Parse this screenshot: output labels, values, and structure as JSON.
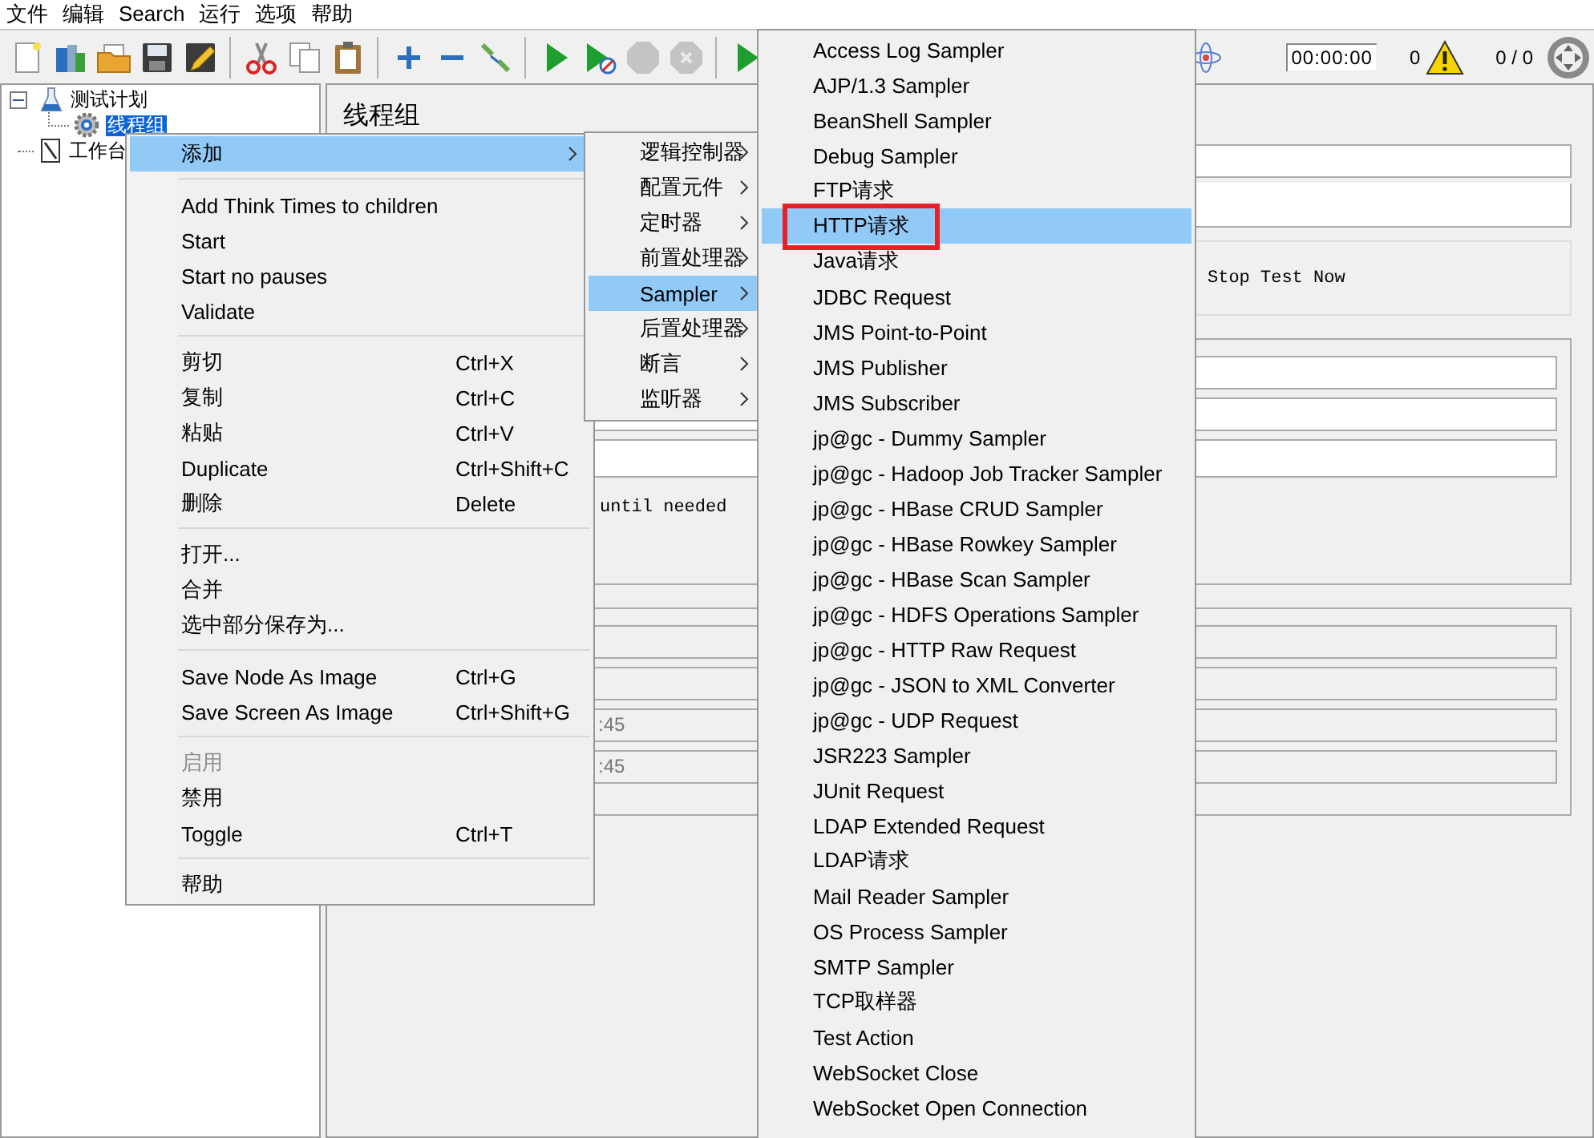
{
  "menubar": [
    {
      "label": "文件"
    },
    {
      "label": "编辑"
    },
    {
      "label": "Search"
    },
    {
      "label": "运行"
    },
    {
      "label": "选项"
    },
    {
      "label": "帮助"
    }
  ],
  "toolbar": [
    {
      "kind": "new",
      "disabled": false
    },
    {
      "kind": "templates",
      "disabled": false
    },
    {
      "kind": "open",
      "disabled": false
    },
    {
      "kind": "save",
      "disabled": false
    },
    {
      "kind": "edit",
      "disabled": false
    },
    {
      "kind": "separator"
    },
    {
      "kind": "cut",
      "disabled": false
    },
    {
      "kind": "copy",
      "disabled": false
    },
    {
      "kind": "paste",
      "disabled": false
    },
    {
      "kind": "separator"
    },
    {
      "kind": "expand",
      "disabled": false
    },
    {
      "kind": "collapse",
      "disabled": false
    },
    {
      "kind": "toggle",
      "disabled": false
    },
    {
      "kind": "separator"
    },
    {
      "kind": "start",
      "disabled": false
    },
    {
      "kind": "start_no_pauses",
      "disabled": false
    },
    {
      "kind": "stop",
      "disabled": true
    },
    {
      "kind": "shutdown",
      "disabled": true
    },
    {
      "kind": "separator"
    },
    {
      "kind": "remote",
      "disabled": false
    }
  ],
  "status": {
    "timer": "00:00:00",
    "error_count": "0",
    "threads": "0 / 0"
  },
  "tree": [
    {
      "kind": "plan",
      "label": "测试计划",
      "expanded": true,
      "selected": false,
      "children": [
        {
          "kind": "thread_group",
          "label": "线程组",
          "selected": true
        }
      ]
    },
    {
      "kind": "workbench",
      "label": "工作台",
      "selected": false
    }
  ],
  "panel": {
    "title": "线程组",
    "action_option": {
      "label": "Stop Test Now"
    },
    "delay_note": "until needed",
    "times": [
      ":45",
      ":45"
    ]
  },
  "context_menu": [
    {
      "kind": "item",
      "label": "添加",
      "arrow": true,
      "disabled": false,
      "selected": true
    },
    {
      "kind": "separator"
    },
    {
      "kind": "item",
      "label": "Add Think Times to children",
      "arrow": false,
      "disabled": false,
      "selected": false
    },
    {
      "kind": "item",
      "label": "Start",
      "arrow": false,
      "disabled": false,
      "selected": false
    },
    {
      "kind": "item",
      "label": "Start no pauses",
      "arrow": false,
      "disabled": false,
      "selected": false
    },
    {
      "kind": "item",
      "label": "Validate",
      "arrow": false,
      "disabled": false,
      "selected": false
    },
    {
      "kind": "separator"
    },
    {
      "kind": "item",
      "label": "剪切",
      "shortcut": "Ctrl+X",
      "arrow": false,
      "disabled": false,
      "selected": false
    },
    {
      "kind": "item",
      "label": "复制",
      "shortcut": "Ctrl+C",
      "arrow": false,
      "disabled": false,
      "selected": false
    },
    {
      "kind": "item",
      "label": "粘贴",
      "shortcut": "Ctrl+V",
      "arrow": false,
      "disabled": false,
      "selected": false
    },
    {
      "kind": "item",
      "label": "Duplicate",
      "shortcut": "Ctrl+Shift+C",
      "arrow": false,
      "disabled": false,
      "selected": false
    },
    {
      "kind": "item",
      "label": "删除",
      "shortcut": "Delete",
      "arrow": false,
      "disabled": false,
      "selected": false
    },
    {
      "kind": "separator"
    },
    {
      "kind": "item",
      "label": "打开...",
      "arrow": false,
      "disabled": false,
      "selected": false
    },
    {
      "kind": "item",
      "label": "合并",
      "arrow": false,
      "disabled": false,
      "selected": false
    },
    {
      "kind": "item",
      "label": "选中部分保存为...",
      "arrow": false,
      "disabled": false,
      "selected": false
    },
    {
      "kind": "separator"
    },
    {
      "kind": "item",
      "label": "Save Node As Image",
      "shortcut": "Ctrl+G",
      "arrow": false,
      "disabled": false,
      "selected": false
    },
    {
      "kind": "item",
      "label": "Save Screen As Image",
      "shortcut": "Ctrl+Shift+G",
      "arrow": false,
      "disabled": false,
      "selected": false
    },
    {
      "kind": "separator"
    },
    {
      "kind": "item",
      "label": "启用",
      "arrow": false,
      "disabled": true,
      "selected": false
    },
    {
      "kind": "item",
      "label": "禁用",
      "arrow": false,
      "disabled": false,
      "selected": false
    },
    {
      "kind": "item",
      "label": "Toggle",
      "shortcut": "Ctrl+T",
      "arrow": false,
      "disabled": false,
      "selected": false
    },
    {
      "kind": "separator"
    },
    {
      "kind": "item",
      "label": "帮助",
      "arrow": false,
      "disabled": false,
      "selected": false
    }
  ],
  "add_menu": [
    {
      "label": "逻辑控制器",
      "selected": false
    },
    {
      "label": "配置元件",
      "selected": false
    },
    {
      "label": "定时器",
      "selected": false
    },
    {
      "label": "前置处理器",
      "selected": false
    },
    {
      "label": "Sampler",
      "selected": true
    },
    {
      "label": "后置处理器",
      "selected": false
    },
    {
      "label": "断言",
      "selected": false
    },
    {
      "label": "监听器",
      "selected": false
    }
  ],
  "sampler_menu": [
    {
      "label": "Access Log Sampler",
      "selected": false,
      "annotated": false
    },
    {
      "label": "AJP/1.3 Sampler",
      "selected": false,
      "annotated": false
    },
    {
      "label": "BeanShell Sampler",
      "selected": false,
      "annotated": false
    },
    {
      "label": "Debug Sampler",
      "selected": false,
      "annotated": false
    },
    {
      "label": "FTP请求",
      "selected": false,
      "annotated": false
    },
    {
      "label": "HTTP请求",
      "selected": true,
      "annotated": true
    },
    {
      "label": "Java请求",
      "selected": false,
      "annotated": false
    },
    {
      "label": "JDBC Request",
      "selected": false,
      "annotated": false
    },
    {
      "label": "JMS Point-to-Point",
      "selected": false,
      "annotated": false
    },
    {
      "label": "JMS Publisher",
      "selected": false,
      "annotated": false
    },
    {
      "label": "JMS Subscriber",
      "selected": false,
      "annotated": false
    },
    {
      "label": "jp@gc - Dummy Sampler",
      "selected": false,
      "annotated": false
    },
    {
      "label": "jp@gc - Hadoop Job Tracker Sampler",
      "selected": false,
      "annotated": false
    },
    {
      "label": "jp@gc - HBase CRUD Sampler",
      "selected": false,
      "annotated": false
    },
    {
      "label": "jp@gc - HBase Rowkey Sampler",
      "selected": false,
      "annotated": false
    },
    {
      "label": "jp@gc - HBase Scan Sampler",
      "selected": false,
      "annotated": false
    },
    {
      "label": "jp@gc - HDFS Operations Sampler",
      "selected": false,
      "annotated": false
    },
    {
      "label": "jp@gc - HTTP Raw Request",
      "selected": false,
      "annotated": false
    },
    {
      "label": "jp@gc - JSON to XML Converter",
      "selected": false,
      "annotated": false
    },
    {
      "label": "jp@gc - UDP Request",
      "selected": false,
      "annotated": false
    },
    {
      "label": "JSR223 Sampler",
      "selected": false,
      "annotated": false
    },
    {
      "label": "JUnit Request",
      "selected": false,
      "annotated": false
    },
    {
      "label": "LDAP Extended Request",
      "selected": false,
      "annotated": false
    },
    {
      "label": "LDAP请求",
      "selected": false,
      "annotated": false
    },
    {
      "label": "Mail Reader Sampler",
      "selected": false,
      "annotated": false
    },
    {
      "label": "OS Process Sampler",
      "selected": false,
      "annotated": false
    },
    {
      "label": "SMTP Sampler",
      "selected": false,
      "annotated": false
    },
    {
      "label": "TCP取样器",
      "selected": false,
      "annotated": false
    },
    {
      "label": "Test Action",
      "selected": false,
      "annotated": false
    },
    {
      "label": "WebSocket Close",
      "selected": false,
      "annotated": false
    },
    {
      "label": "WebSocket Open Connection",
      "selected": false,
      "annotated": false
    }
  ]
}
